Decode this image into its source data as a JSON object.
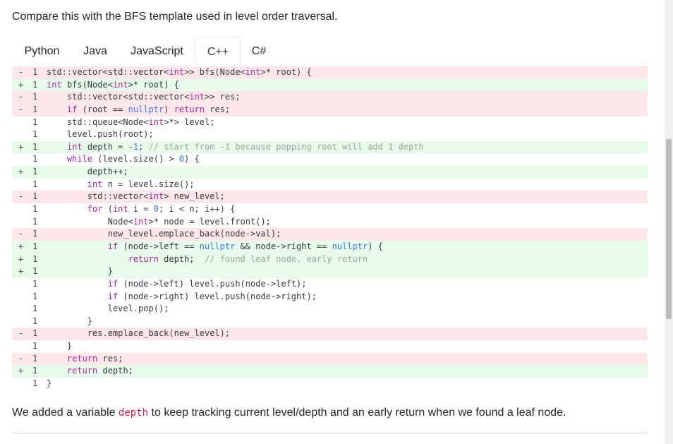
{
  "intro_text": "Compare this with the BFS template used in level order traversal.",
  "tabs": [
    {
      "label": "Python"
    },
    {
      "label": "Java"
    },
    {
      "label": "JavaScript"
    },
    {
      "label": "C++"
    },
    {
      "label": "C#"
    }
  ],
  "active_tab": "C++",
  "diff_lines": [
    {
      "marker": "-",
      "num": "1",
      "type": "del",
      "code": "std::vector<std::vector<int>> bfs(Node<int>* root) {"
    },
    {
      "marker": "+",
      "num": "1",
      "type": "add",
      "code": "int bfs(Node<int>* root) {"
    },
    {
      "marker": "-",
      "num": "1",
      "type": "del",
      "code": "    std::vector<std::vector<int>> res;"
    },
    {
      "marker": "-",
      "num": "1",
      "type": "del",
      "code": "    if (root == nullptr) return res;"
    },
    {
      "marker": "",
      "num": "1",
      "type": "ctx",
      "code": "    std::queue<Node<int>*> level;"
    },
    {
      "marker": "",
      "num": "1",
      "type": "ctx",
      "code": "    level.push(root);"
    },
    {
      "marker": "+",
      "num": "1",
      "type": "add",
      "code": "    int depth = -1; // start from -1 because popping root will add 1 depth"
    },
    {
      "marker": "",
      "num": "1",
      "type": "ctx",
      "code": "    while (level.size() > 0) {"
    },
    {
      "marker": "+",
      "num": "1",
      "type": "add",
      "code": "        depth++;"
    },
    {
      "marker": "",
      "num": "1",
      "type": "ctx",
      "code": "        int n = level.size();"
    },
    {
      "marker": "-",
      "num": "1",
      "type": "del",
      "code": "        std::vector<int> new_level;"
    },
    {
      "marker": "",
      "num": "1",
      "type": "ctx",
      "code": "        for (int i = 0; i < n; i++) {"
    },
    {
      "marker": "",
      "num": "1",
      "type": "ctx",
      "code": "            Node<int>* node = level.front();"
    },
    {
      "marker": "-",
      "num": "1",
      "type": "del",
      "code": "            new_level.emplace_back(node->val);"
    },
    {
      "marker": "+",
      "num": "1",
      "type": "add",
      "code": "            if (node->left == nullptr && node->right == nullptr) {"
    },
    {
      "marker": "+",
      "num": "1",
      "type": "add",
      "code": "                return depth;  // found leaf node, early return"
    },
    {
      "marker": "+",
      "num": "1",
      "type": "add",
      "code": "            }"
    },
    {
      "marker": "",
      "num": "1",
      "type": "ctx",
      "code": "            if (node->left) level.push(node->left);"
    },
    {
      "marker": "",
      "num": "1",
      "type": "ctx",
      "code": "            if (node->right) level.push(node->right);"
    },
    {
      "marker": "",
      "num": "1",
      "type": "ctx",
      "code": "            level.pop();"
    },
    {
      "marker": "",
      "num": "1",
      "type": "ctx",
      "code": "        }"
    },
    {
      "marker": "-",
      "num": "1",
      "type": "del",
      "code": "        res.emplace_back(new_level);"
    },
    {
      "marker": "",
      "num": "1",
      "type": "ctx",
      "code": "    }"
    },
    {
      "marker": "-",
      "num": "1",
      "type": "del",
      "code": "    return res;"
    },
    {
      "marker": "+",
      "num": "1",
      "type": "add",
      "code": "    return depth;"
    },
    {
      "marker": "",
      "num": "1",
      "type": "ctx",
      "code": "}"
    }
  ],
  "outro": {
    "before": "We added a variable ",
    "code": "depth",
    "after": " to keep tracking current level/depth and an early return when we found a leaf node."
  },
  "colors": {
    "deleted_line_bg": "#fde7e9",
    "added_line_bg": "#e6fbe9",
    "keyword": "#a626a4",
    "number": "#4078f2",
    "comment": "#a0a1a7",
    "inline_code": "#c7254e"
  }
}
